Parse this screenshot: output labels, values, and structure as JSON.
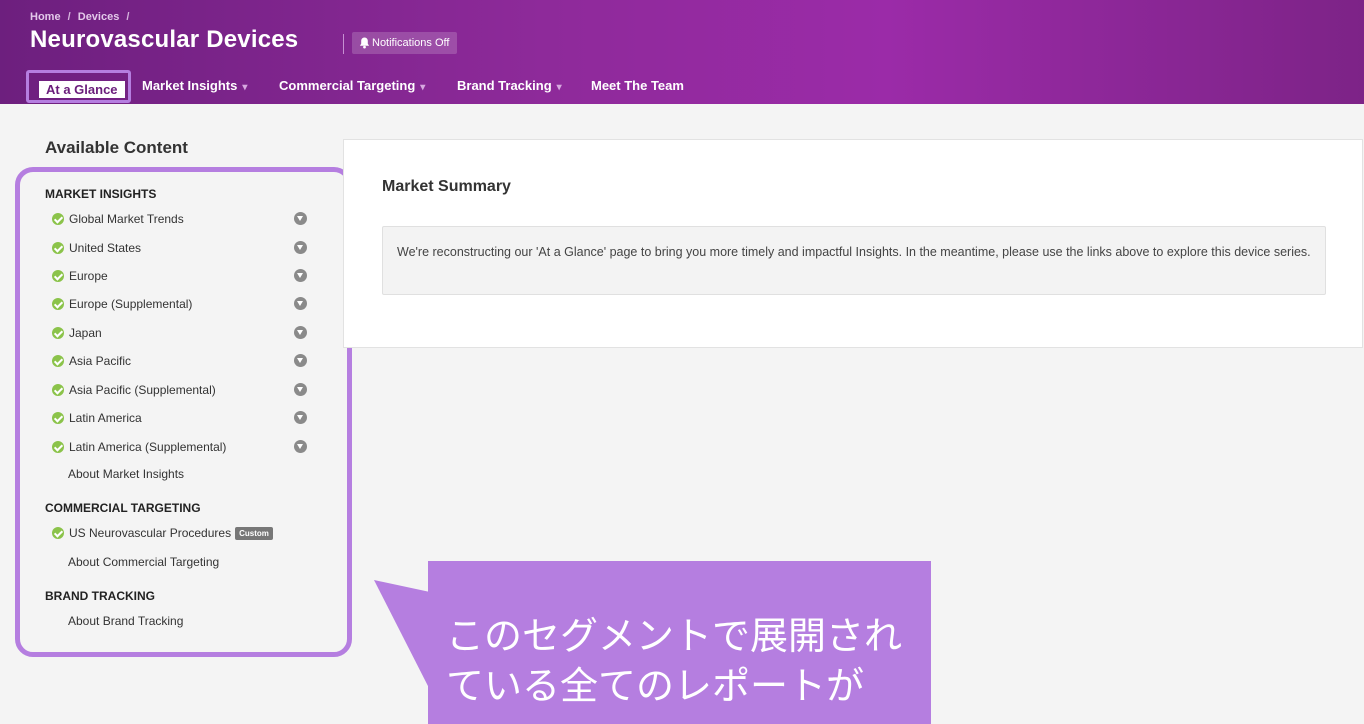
{
  "header": {
    "breadcrumb": [
      "Home",
      "Devices"
    ],
    "breadcrumb_sep": "/",
    "title": "Neurovascular Devices",
    "notifications_label": "Notifications Off"
  },
  "nav": {
    "items": [
      {
        "label": "At a Glance",
        "active": true,
        "dropdown": false
      },
      {
        "label": "Market Insights",
        "dropdown": true
      },
      {
        "label": "Commercial Targeting",
        "dropdown": true
      },
      {
        "label": "Brand Tracking",
        "dropdown": true
      },
      {
        "label": "Meet The Team",
        "dropdown": false
      }
    ],
    "caret": "▾"
  },
  "sidebar": {
    "heading": "Available Content",
    "market_insights": {
      "title": "MARKET INSIGHTS",
      "items": [
        "Global Market Trends",
        "United States",
        "Europe",
        "Europe (Supplemental)",
        "Japan",
        "Asia Pacific",
        "Asia Pacific (Supplemental)",
        "Latin America",
        "Latin America (Supplemental)"
      ],
      "about": "About Market Insights"
    },
    "commercial_targeting": {
      "title": "COMMERCIAL TARGETING",
      "items": [
        "US Neurovascular Procedures"
      ],
      "badge": "Custom",
      "about": "About Commercial Targeting"
    },
    "brand_tracking": {
      "title": "BRAND TRACKING",
      "about": "About Brand Tracking"
    }
  },
  "main": {
    "title": "Market Summary",
    "notice": "We're reconstructing our 'At a Glance' page to bring you more timely and impactful Insights. In the meantime, please use the links above to explore this device series."
  },
  "callout": {
    "line1": "このセグメントで展開され",
    "line2": "ている全てのレポートが"
  },
  "colors": {
    "header_purple": "#8e2a9a",
    "highlight_lavender": "#b57ee0",
    "check_green": "#8bc34a"
  }
}
